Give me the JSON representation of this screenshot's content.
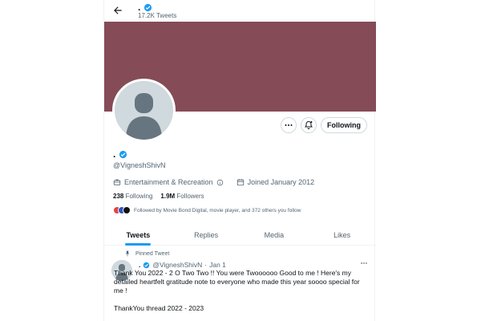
{
  "header": {
    "name": ".",
    "tweet_count": "17.2K Tweets"
  },
  "colors": {
    "banner": "#854b57",
    "verified": "#1d9bf0",
    "accent": "#1d9bf0"
  },
  "profile": {
    "name": ".",
    "handle": "@VigneshShivN",
    "category": "Entertainment & Recreation",
    "joined": "Joined January 2012",
    "following_count": "238",
    "following_label": "Following",
    "followers_count": "1.9M",
    "followers_label": "Followers",
    "followed_by": "Followed by Movie Bond Digital, movie player, and 372 others you follow"
  },
  "actions": {
    "more_icon": "more-icon",
    "notify_icon": "bell-plus-icon",
    "follow_label": "Following"
  },
  "tabs": [
    {
      "label": "Tweets",
      "active": true
    },
    {
      "label": "Replies",
      "active": false
    },
    {
      "label": "Media",
      "active": false
    },
    {
      "label": "Likes",
      "active": false
    }
  ],
  "tweet": {
    "pinned_label": "Pinned Tweet",
    "name": ".",
    "handle": "@VigneshShivN",
    "separator": "·",
    "date": "Jan 1",
    "line1": "Thank You 2022 - 2 O Two Two !! You were Twoooooo Good to me ! Here's my detailed heartfelt gratitude note to everyone who made this year soooo special for me !",
    "line2": "ThankYou thread 2022 - 2023"
  }
}
